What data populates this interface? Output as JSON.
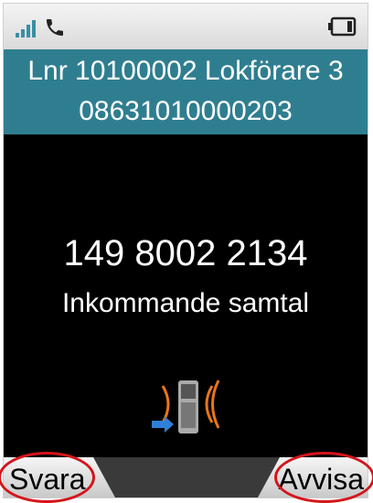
{
  "statusbar": {
    "signal_icon": "signal-strength-icon",
    "call_icon": "phone-handset-icon",
    "battery_icon": "battery-icon"
  },
  "header": {
    "line1": "Lnr 10100002 Lokförare 3",
    "line2": "08631010000203",
    "background": "#2f7e90"
  },
  "call": {
    "number": "149 8002 2134",
    "status": "Inkommande samtal",
    "icon": "incoming-call-ringing-phone-icon"
  },
  "softkeys": {
    "left_label": "Svara",
    "right_label": "Avvisa"
  },
  "highlight_color": "#d4151b"
}
